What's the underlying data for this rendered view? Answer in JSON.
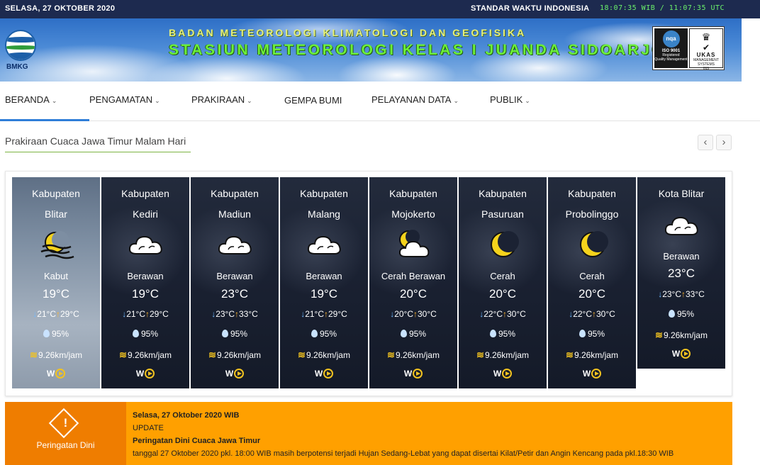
{
  "topbar": {
    "date": "SELASA, 27 OKTOBER 2020",
    "standard_label": "STANDAR WAKTU INDONESIA",
    "time": "18:07:35 WIB / 11:07:35 UTC"
  },
  "banner": {
    "logo_text": "BMKG",
    "line1": "BADAN METEOROLOGI KLIMATOLOGI DAN GEOFISIKA",
    "line2": "STASIUN METEOROLOGI KELAS I JUANDA SIDOARJO",
    "cert_nqa": "nqa",
    "cert_iso": "ISO 9001",
    "cert_registered": "Registered",
    "cert_quality": "Quality Management",
    "cert_ukas": "UKAS",
    "cert_ukas_sub": "MANAGEMENT SYSTEMS",
    "cert_ukas_num": "015"
  },
  "nav": {
    "items": [
      {
        "label": "BERANDA",
        "dropdown": true
      },
      {
        "label": "PENGAMATAN",
        "dropdown": true
      },
      {
        "label": "PRAKIRAAN",
        "dropdown": true
      },
      {
        "label": "GEMPA BUMI",
        "dropdown": false
      },
      {
        "label": "PELAYANAN DATA",
        "dropdown": true
      },
      {
        "label": "PUBLIK",
        "dropdown": true
      }
    ],
    "chevron": "⌄"
  },
  "section": {
    "title": "Prakiraan Cuaca Jawa Timur Malam Hari",
    "prev": "‹",
    "next": "›"
  },
  "forecasts": [
    {
      "type": "Kabupaten",
      "name": "Blitar",
      "icon": "fog-moon-icon",
      "condition": "Kabut",
      "temp": "19°C",
      "min": "21°C",
      "max": "29°C",
      "humidity": "95%",
      "wind": "9.26km/jam",
      "dir": "W"
    },
    {
      "type": "Kabupaten",
      "name": "Kediri",
      "icon": "cloud-icon",
      "condition": "Berawan",
      "temp": "19°C",
      "min": "21°C",
      "max": "29°C",
      "humidity": "95%",
      "wind": "9.26km/jam",
      "dir": "W"
    },
    {
      "type": "Kabupaten",
      "name": "Madiun",
      "icon": "cloud-icon",
      "condition": "Berawan",
      "temp": "23°C",
      "min": "23°C",
      "max": "33°C",
      "humidity": "95%",
      "wind": "9.26km/jam",
      "dir": "W"
    },
    {
      "type": "Kabupaten",
      "name": "Malang",
      "icon": "cloud-icon",
      "condition": "Berawan",
      "temp": "19°C",
      "min": "21°C",
      "max": "29°C",
      "humidity": "95%",
      "wind": "9.26km/jam",
      "dir": "W"
    },
    {
      "type": "Kabupaten",
      "name": "Mojokerto",
      "icon": "moon-cloud-icon",
      "condition": "Cerah Berawan",
      "temp": "20°C",
      "min": "20°C",
      "max": "30°C",
      "humidity": "95%",
      "wind": "9.26km/jam",
      "dir": "W"
    },
    {
      "type": "Kabupaten",
      "name": "Pasuruan",
      "icon": "moon-icon",
      "condition": "Cerah",
      "temp": "20°C",
      "min": "22°C",
      "max": "30°C",
      "humidity": "95%",
      "wind": "9.26km/jam",
      "dir": "W"
    },
    {
      "type": "Kabupaten",
      "name": "Probolinggo",
      "icon": "moon-icon",
      "condition": "Cerah",
      "temp": "20°C",
      "min": "22°C",
      "max": "30°C",
      "humidity": "95%",
      "wind": "9.26km/jam",
      "dir": "W"
    },
    {
      "type": "Kota Blitar",
      "name": "",
      "icon": "cloud-icon",
      "condition": "Berawan",
      "temp": "23°C",
      "min": "23°C",
      "max": "33°C",
      "humidity": "95%",
      "wind": "9.26km/jam",
      "dir": "W"
    }
  ],
  "warning": {
    "label": "Peringatan Dini",
    "date": "Selasa, 27 Oktober 2020 WIB",
    "update": "UPDATE",
    "title": "Peringatan Dini Cuaca Jawa Timur",
    "text": "tanggal 27 Oktober 2020 pkl. 18:00 WIB masih berpotensi terjadi Hujan Sedang-Lebat yang dapat disertai Kilat/Petir dan Angin Kencang pada pkl.18:30 WIB"
  }
}
